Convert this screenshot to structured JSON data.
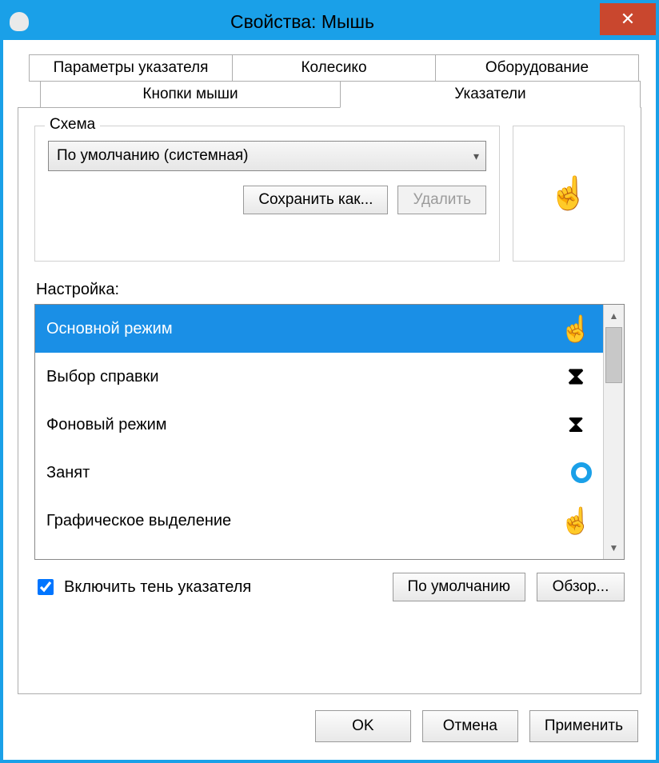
{
  "window": {
    "title": "Свойства: Мышь"
  },
  "tabs": {
    "row1": [
      "Параметры указателя",
      "Колесико",
      "Оборудование"
    ],
    "row2": [
      "Кнопки мыши",
      "Указатели"
    ],
    "active": "Указатели"
  },
  "scheme": {
    "legend": "Схема",
    "selected": "По умолчанию (системная)",
    "save_as": "Сохранить как...",
    "delete": "Удалить"
  },
  "customize_label": "Настройка:",
  "cursors": [
    {
      "label": "Основной режим",
      "icon": "hand",
      "selected": true
    },
    {
      "label": "Выбор справки",
      "icon": "hourglass-bold",
      "selected": false
    },
    {
      "label": "Фоновый режим",
      "icon": "hourglass",
      "selected": false
    },
    {
      "label": "Занят",
      "icon": "ring",
      "selected": false
    },
    {
      "label": "Графическое выделение",
      "icon": "hand",
      "selected": false
    }
  ],
  "shadow": {
    "label": "Включить тень указателя",
    "checked": true
  },
  "buttons": {
    "defaults": "По умолчанию",
    "browse": "Обзор..."
  },
  "dialog": {
    "ok": "OK",
    "cancel": "Отмена",
    "apply": "Применить"
  }
}
